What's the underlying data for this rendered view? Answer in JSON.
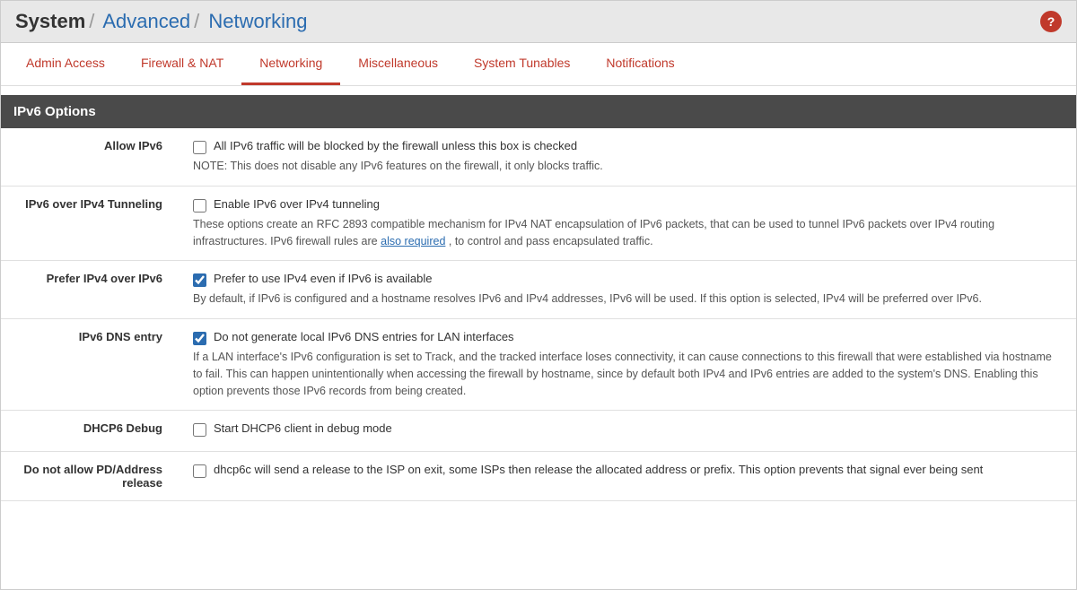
{
  "breadcrumb": {
    "system": "System",
    "sep1": "/",
    "advanced": "Advanced",
    "sep2": "/",
    "networking": "Networking"
  },
  "tabs": [
    {
      "id": "admin-access",
      "label": "Admin Access",
      "active": false
    },
    {
      "id": "firewall-nat",
      "label": "Firewall & NAT",
      "active": false
    },
    {
      "id": "networking",
      "label": "Networking",
      "active": true
    },
    {
      "id": "miscellaneous",
      "label": "Miscellaneous",
      "active": false
    },
    {
      "id": "system-tunables",
      "label": "System Tunables",
      "active": false
    },
    {
      "id": "notifications",
      "label": "Notifications",
      "active": false
    }
  ],
  "section": {
    "title": "IPv6 Options"
  },
  "rows": [
    {
      "label": "Allow IPv6",
      "checkbox_label": "All IPv6 traffic will be blocked by the firewall unless this box is checked",
      "checked": false,
      "desc": "NOTE: This does not disable any IPv6 features on the firewall, it only blocks traffic.",
      "has_link": false
    },
    {
      "label": "IPv6 over IPv4 Tunneling",
      "checkbox_label": "Enable IPv6 over IPv4 tunneling",
      "checked": false,
      "desc": "These options create an RFC 2893 compatible mechanism for IPv4 NAT encapsulation of IPv6 packets, that can be used to tunnel IPv6 packets over IPv4 routing infrastructures. IPv6 firewall rules are",
      "link_text": "also required",
      "desc_after": ", to control and pass encapsulated traffic.",
      "has_link": true
    },
    {
      "label": "Prefer IPv4 over IPv6",
      "checkbox_label": "Prefer to use IPv4 even if IPv6 is available",
      "checked": true,
      "desc": "By default, if IPv6 is configured and a hostname resolves IPv6 and IPv4 addresses, IPv6 will be used. If this option is selected, IPv4 will be preferred over IPv6.",
      "has_link": false
    },
    {
      "label": "IPv6 DNS entry",
      "checkbox_label": "Do not generate local IPv6 DNS entries for LAN interfaces",
      "checked": true,
      "desc": "If a LAN interface's IPv6 configuration is set to Track, and the tracked interface loses connectivity, it can cause connections to this firewall that were established via hostname to fail. This can happen unintentionally when accessing the firewall by hostname, since by default both IPv4 and IPv6 entries are added to the system's DNS. Enabling this option prevents those IPv6 records from being created.",
      "has_link": false
    },
    {
      "label": "DHCP6 Debug",
      "checkbox_label": "Start DHCP6 client in debug mode",
      "checked": false,
      "desc": "",
      "has_link": false
    },
    {
      "label": "Do not allow PD/Address release",
      "checkbox_label": "dhcp6c will send a release to the ISP on exit, some ISPs then release the allocated address or prefix. This option prevents that signal ever being sent",
      "checked": false,
      "desc": "",
      "has_link": false
    }
  ]
}
